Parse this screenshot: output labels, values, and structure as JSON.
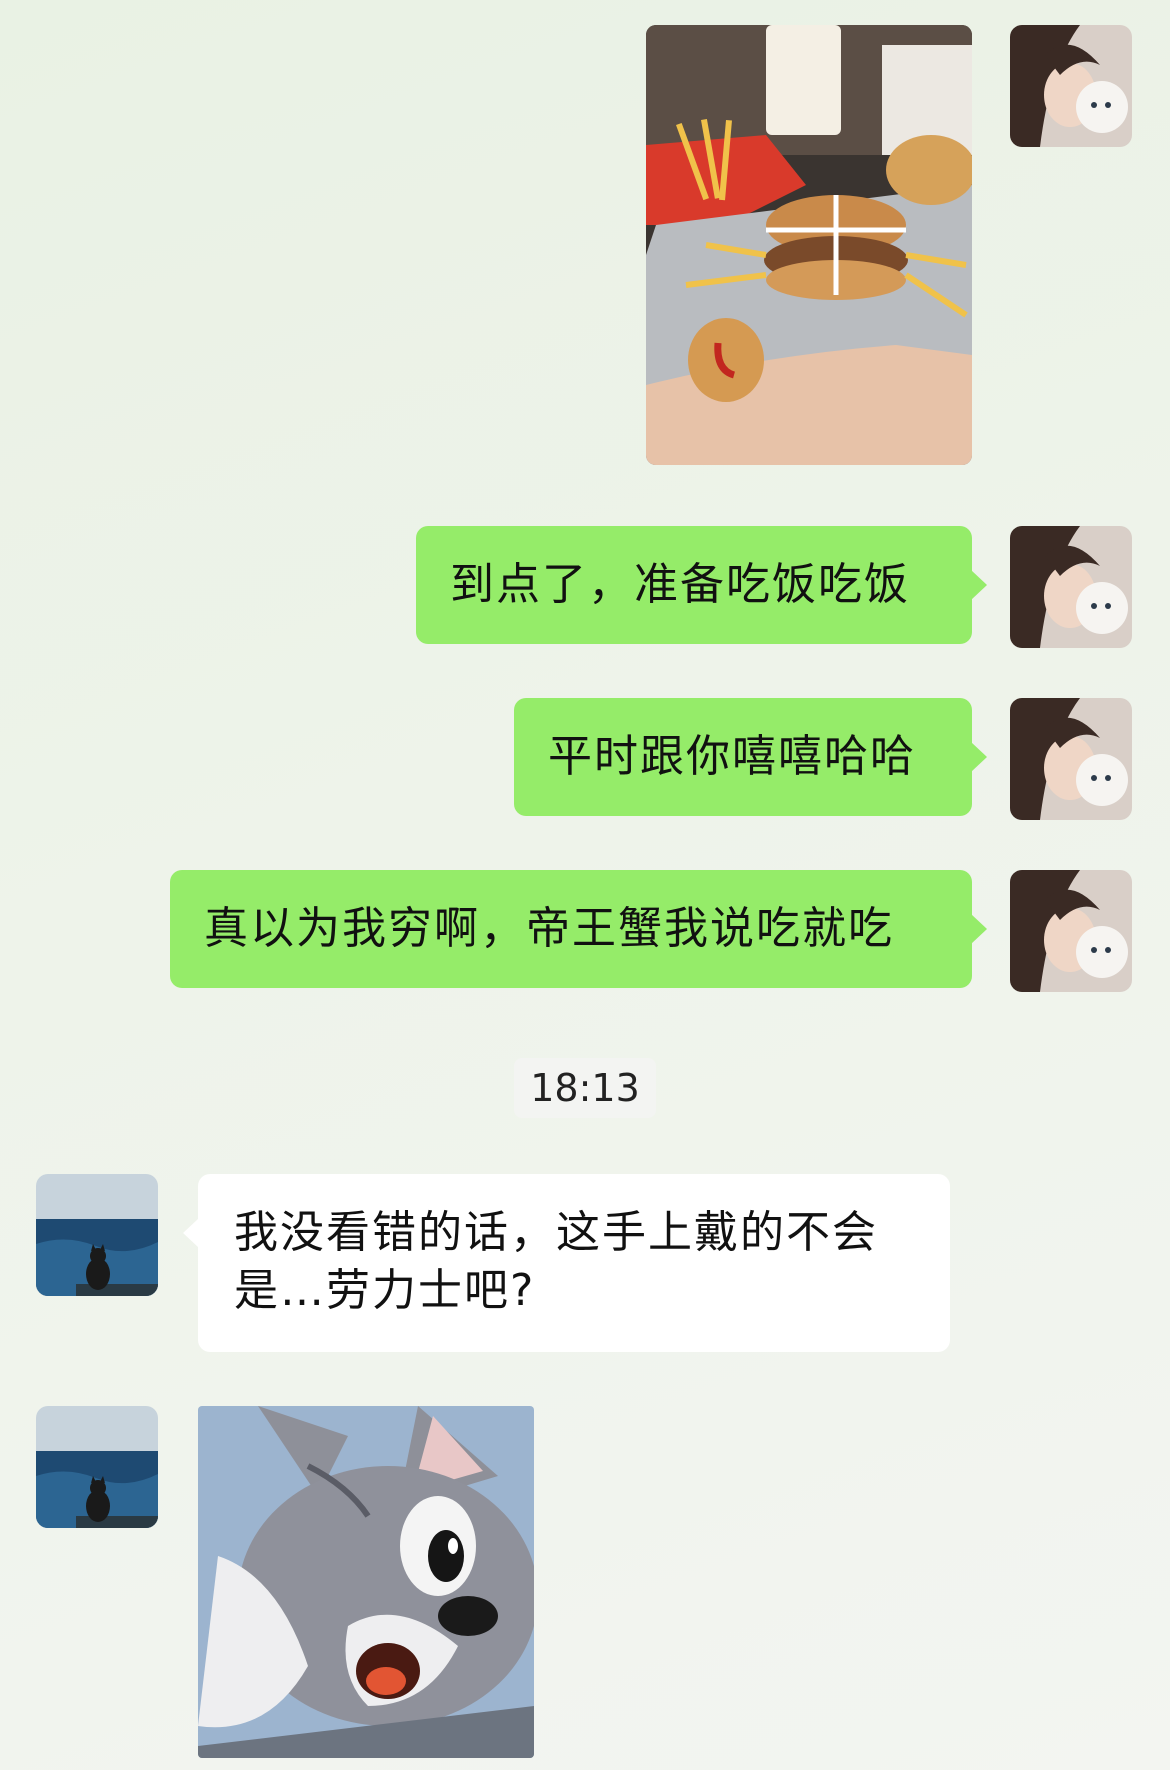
{
  "messages": [
    {
      "text": "到点了，准备吃饭吃饭"
    },
    {
      "text": "平时跟你嘻嘻哈哈"
    },
    {
      "text": "真以为我穷啊，帝王蟹我说吃就吃"
    }
  ],
  "timestamp": "18:13",
  "incoming": {
    "line1": "我没看错的话，这手上戴的不会",
    "line2": "是…劳力士吧?"
  },
  "images": {
    "food_photo": "mcdonalds-meal-crab-burger-photo",
    "sticker": "tom-cat-shocked-sticker"
  },
  "colors": {
    "outgoing_bubble": "#95ec69",
    "incoming_bubble": "#ffffff",
    "background": "#edf3e9"
  }
}
